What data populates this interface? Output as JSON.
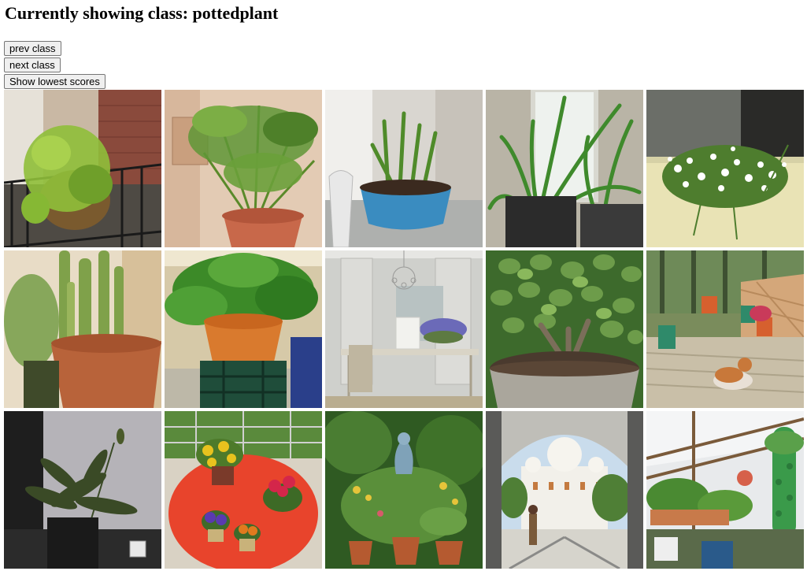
{
  "page": {
    "heading": "Currently showing class: pottedplant"
  },
  "buttons": {
    "prev_label": "prev class",
    "next_label": "next class",
    "lowest_label": "Show lowest scores"
  },
  "gallery": {
    "images": [
      {
        "subject": "hanging basket plant on balcony railing"
      },
      {
        "subject": "umbrella palm in terracotta pot"
      },
      {
        "subject": "sprouting bulbs in blue bowl"
      },
      {
        "subject": "spider plants by window"
      },
      {
        "subject": "white alyssum hanging basket"
      },
      {
        "subject": "snake plant in terracotta pot"
      },
      {
        "subject": "peace lily in orange pot on crate"
      },
      {
        "subject": "dining room with chandelier and lavender"
      },
      {
        "subject": "jade plant in stone pot"
      },
      {
        "subject": "potted plants on deck with dog"
      },
      {
        "subject": "peace lily in dark corner"
      },
      {
        "subject": "pansies and cyclamen on red table"
      },
      {
        "subject": "garden plants and statue"
      },
      {
        "subject": "archway view of white temple"
      },
      {
        "subject": "greenhouse with vertical planter"
      }
    ]
  }
}
